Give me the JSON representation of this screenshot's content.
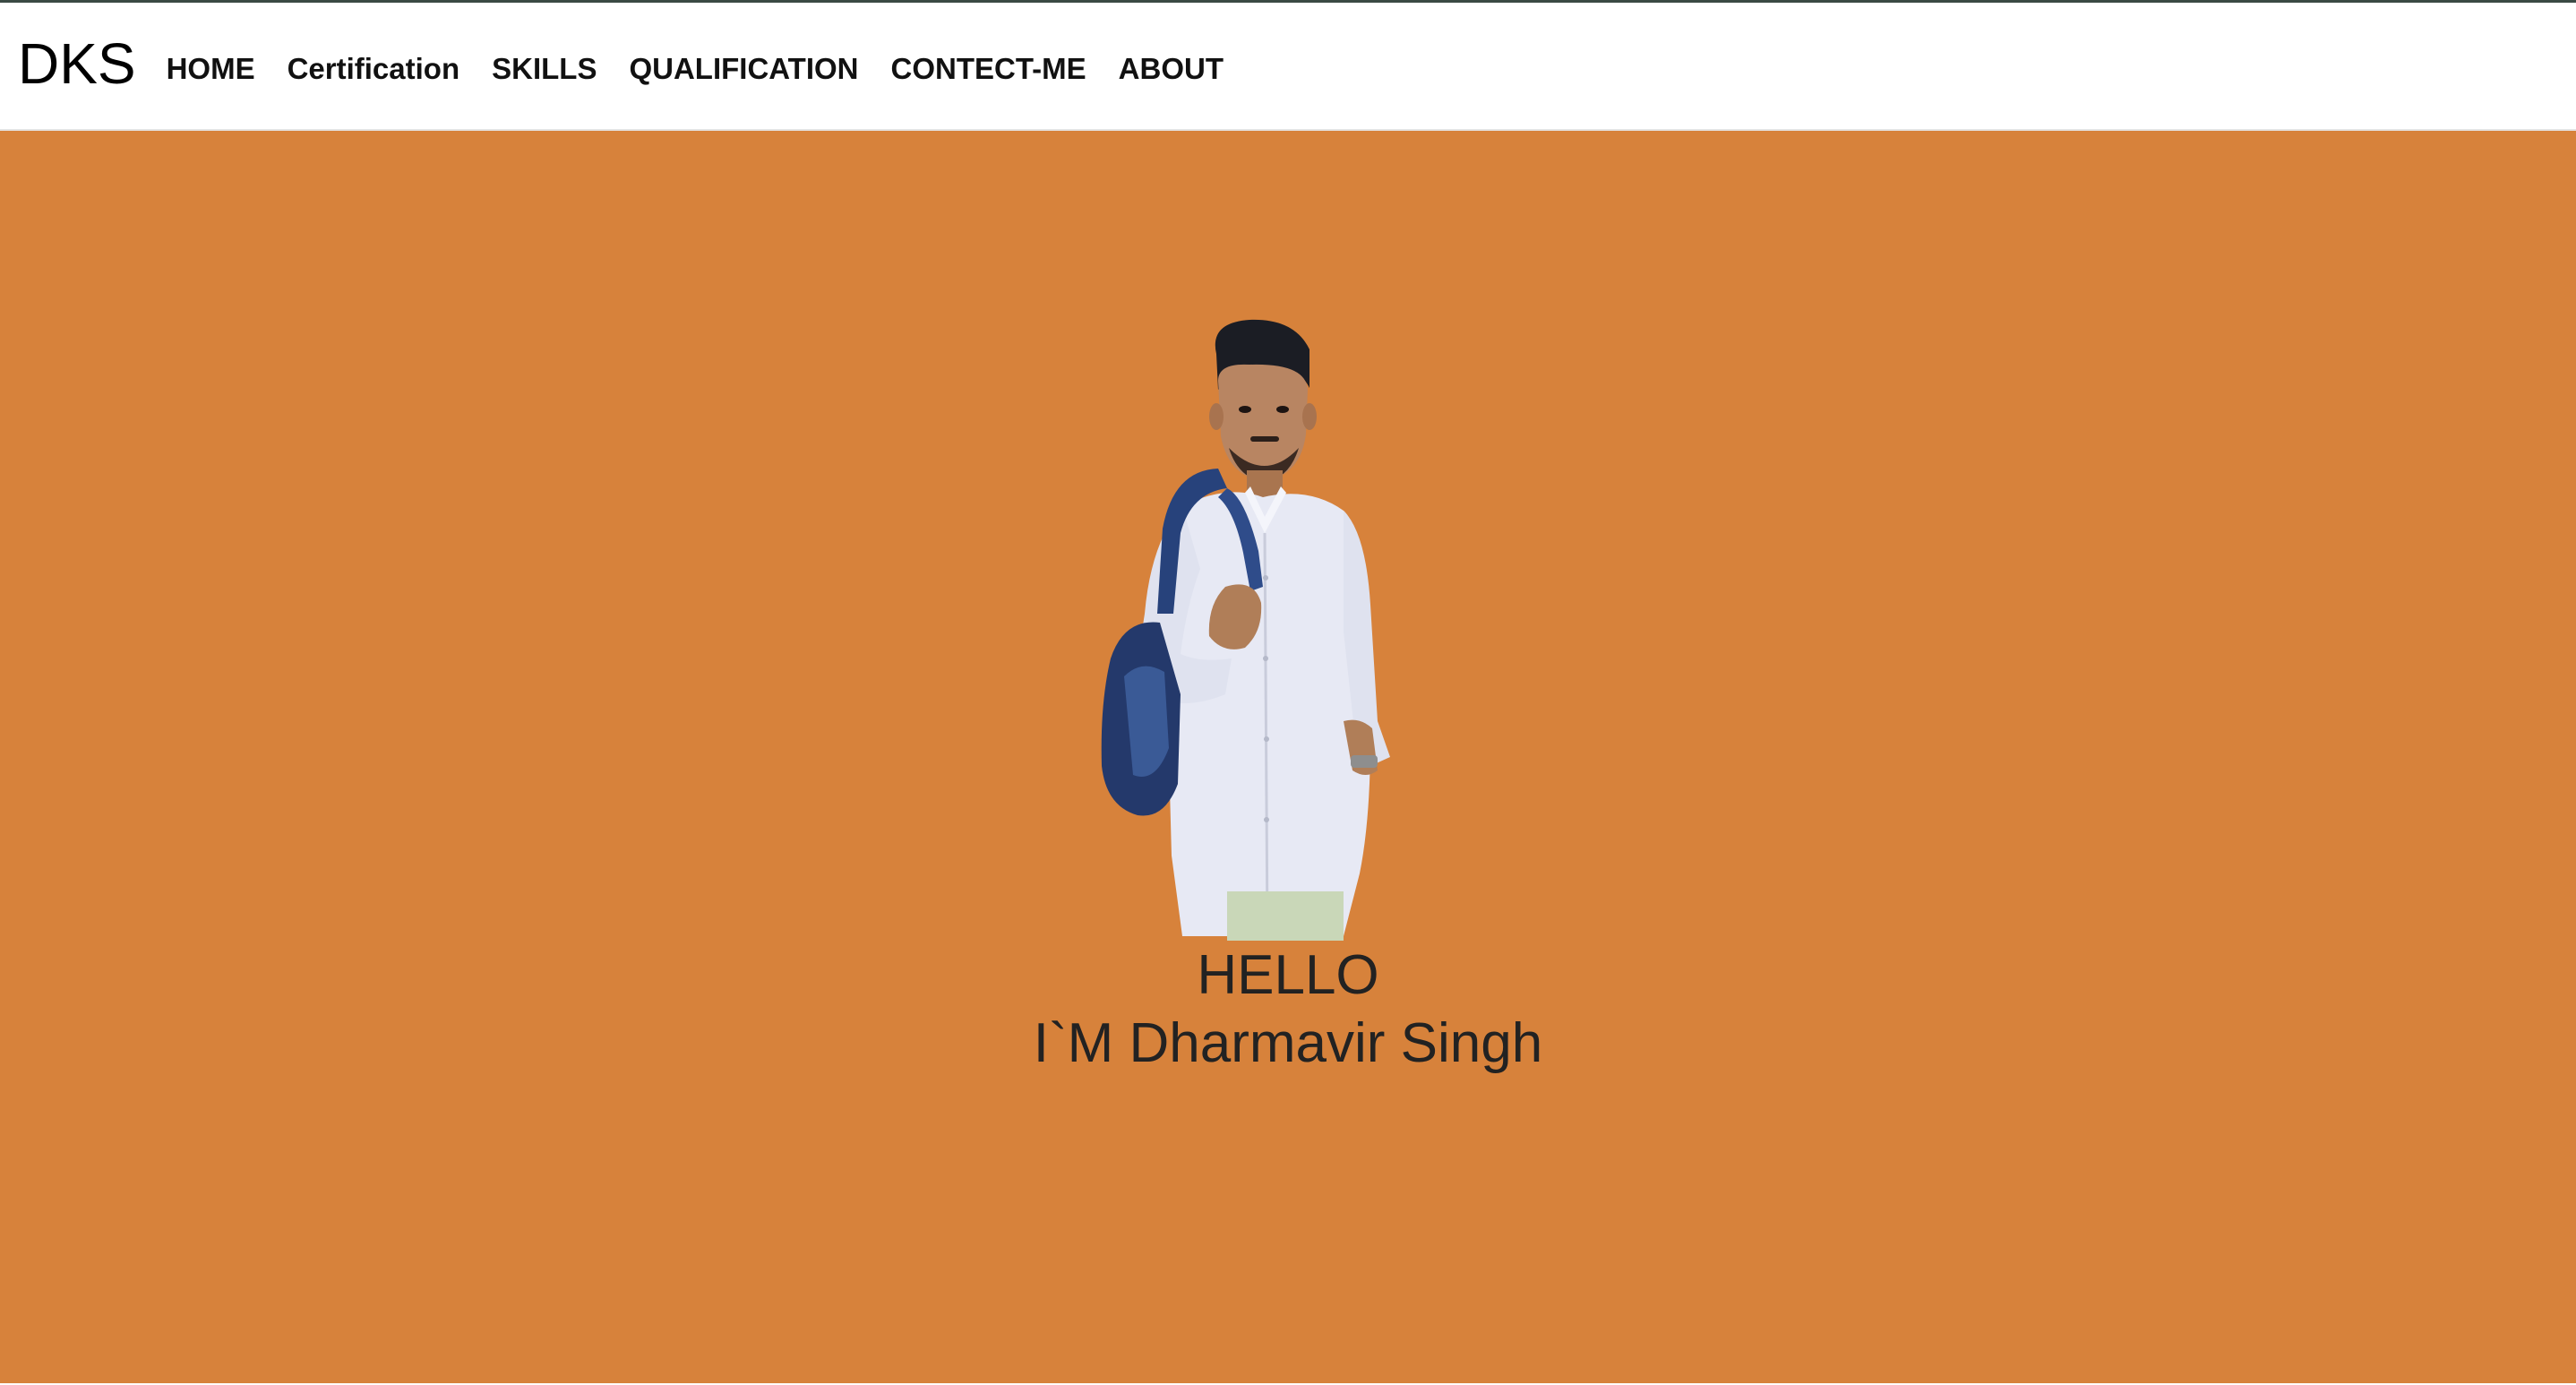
{
  "brand": "DKS",
  "nav": {
    "items": [
      "HOME",
      "Certification",
      "SKILLS",
      "QUALIFICATION",
      "CONTECT-ME",
      "ABOUT"
    ]
  },
  "hero": {
    "greeting": "HELLO",
    "name_line": "I`M Dharmavir Singh",
    "background_color": "#d7823b"
  }
}
